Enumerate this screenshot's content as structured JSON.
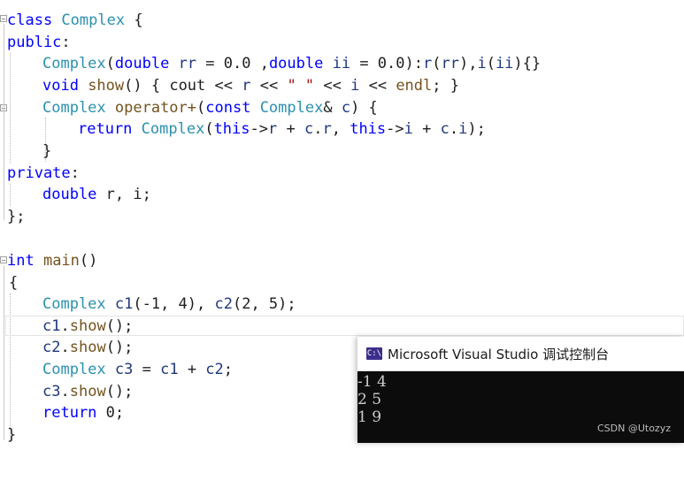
{
  "editor": {
    "lines": {
      "l1": [
        "class",
        " Complex",
        " {"
      ],
      "l2": [
        "public",
        ":"
      ],
      "l3": [
        "Complex",
        "(",
        "double",
        " rr",
        " = 0.0 ,",
        "double",
        " ii",
        " = 0.0):",
        "r",
        "(",
        "rr",
        "),",
        "i",
        "(",
        "ii",
        "){}"
      ],
      "l4": [
        "void",
        " show",
        "() { ",
        "cout",
        " << ",
        "r",
        " << ",
        "\" \"",
        " << ",
        "i",
        " << ",
        "endl",
        "; }"
      ],
      "l5": [
        "Complex",
        " operator+",
        "(",
        "const",
        " Complex",
        "& ",
        "c",
        ") {"
      ],
      "l6": [
        "return",
        " Complex",
        "(",
        "this",
        "->",
        "r",
        " + ",
        "c",
        ".",
        "r",
        ", ",
        "this",
        "->",
        "i",
        " + ",
        "c",
        ".",
        "i",
        ");"
      ],
      "l7": [
        "}"
      ],
      "l8": [
        "private",
        ":"
      ],
      "l9": [
        "double",
        " r, i;"
      ],
      "l10": [
        "};"
      ],
      "l11": [
        "int",
        " main",
        "()"
      ],
      "l12": [
        "{"
      ],
      "l13": [
        "Complex",
        " c1",
        "(-1, 4), ",
        "c2",
        "(2, 5);"
      ],
      "l14": [
        "c1",
        ".",
        "show",
        "();"
      ],
      "l15": [
        "c2",
        ".",
        "show",
        "();"
      ],
      "l16": [
        "Complex",
        " c3",
        " = ",
        "c1",
        " + ",
        "c2",
        ";"
      ],
      "l17": [
        "c3",
        ".",
        "show",
        "();"
      ],
      "l18": [
        "return",
        " 0;"
      ],
      "l19": [
        "}"
      ]
    }
  },
  "console": {
    "icon_text": "C:\\",
    "title": "Microsoft Visual Studio 调试控制台",
    "output": [
      "-1 4",
      "2 5",
      "1 9"
    ]
  },
  "watermark": "CSDN @Utozyz",
  "colors": {
    "keyword": "#0000ff",
    "type": "#2b91af",
    "function": "#74531f",
    "variable": "#1f377f",
    "string": "#a31515",
    "console_bg": "#0c0c0c",
    "console_text": "#cccccc"
  }
}
